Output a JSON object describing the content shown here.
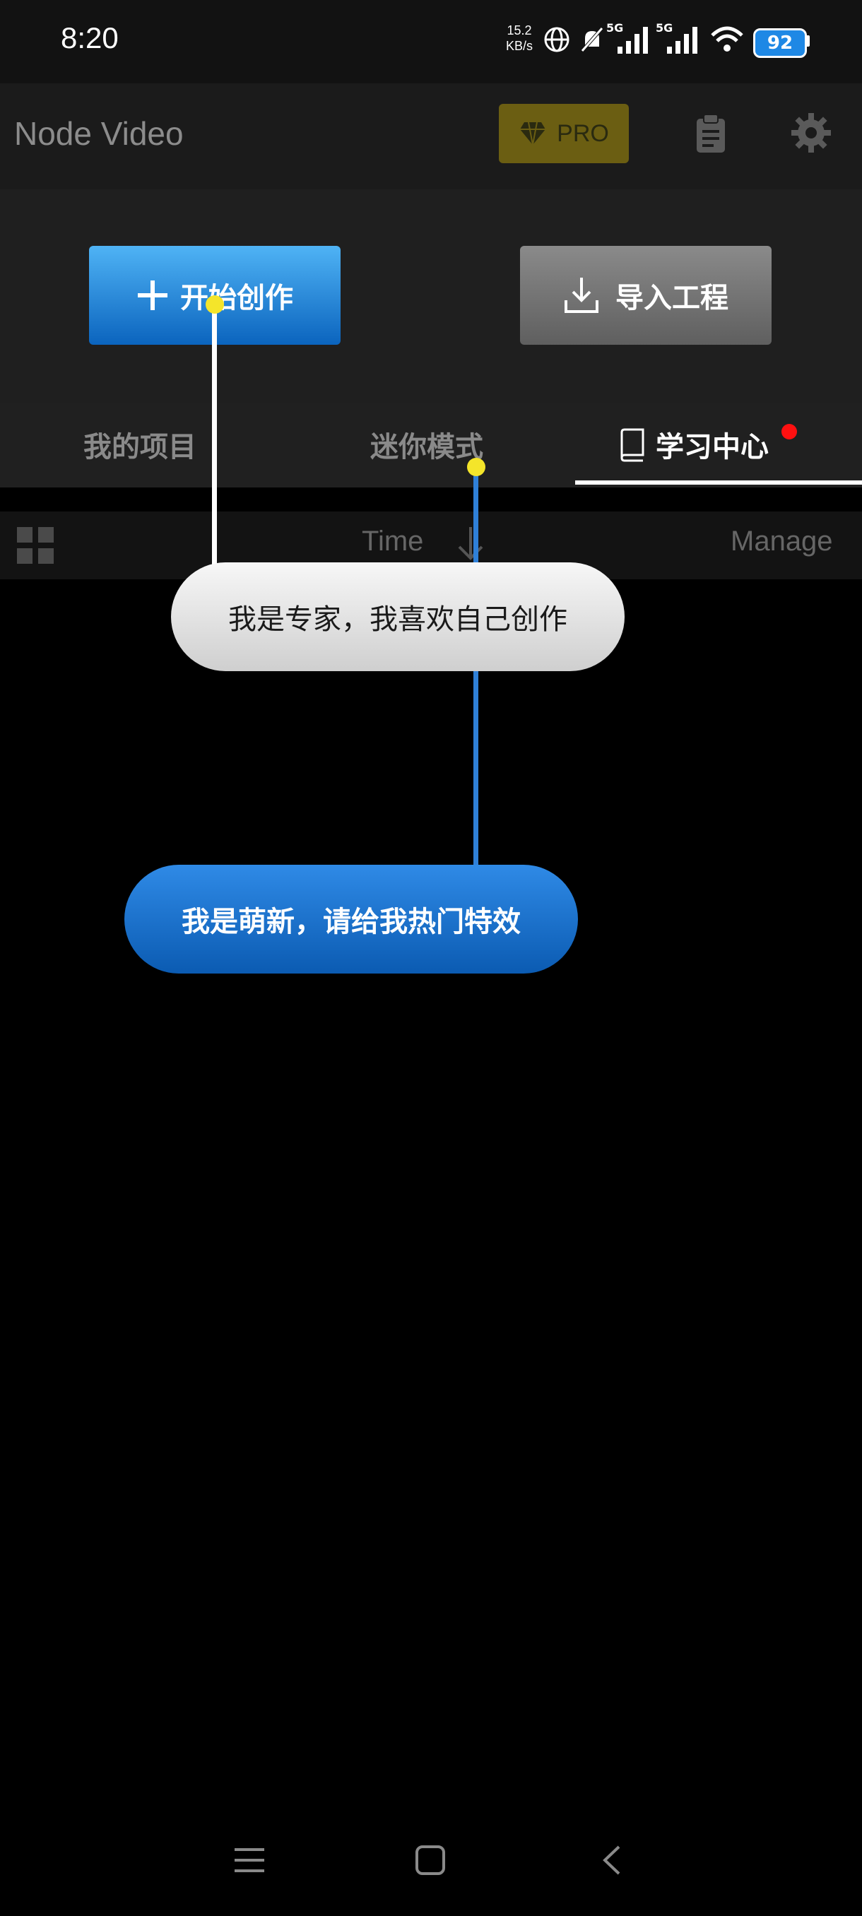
{
  "status_bar": {
    "time": "8:20",
    "speed_value": "15.2",
    "speed_unit": "KB/s",
    "signal1_label": "5G",
    "signal2_label": "5G",
    "battery": "92"
  },
  "app_bar": {
    "title": "Node Video",
    "pro_label": "PRO",
    "icons": [
      "diamond-icon",
      "clipboard-icon",
      "gear-icon"
    ]
  },
  "actions": {
    "start_label": "开始创作",
    "import_label": "导入工程"
  },
  "tabs": [
    {
      "label": "我的项目",
      "active": false
    },
    {
      "label": "迷你模式",
      "active": false
    },
    {
      "label": "学习中心",
      "active": true
    }
  ],
  "sort_bar": {
    "sort_label": "Time",
    "manage_label": "Manage"
  },
  "guide": {
    "expert_option": "我是专家，我喜欢自己创作",
    "newbie_option": "我是萌新，请给我热门特效"
  },
  "colors": {
    "accent_blue": "#0b64be",
    "pro_gold": "#6b5e12",
    "highlight_yellow": "#f4e52a",
    "badge_red": "#ff1010"
  }
}
